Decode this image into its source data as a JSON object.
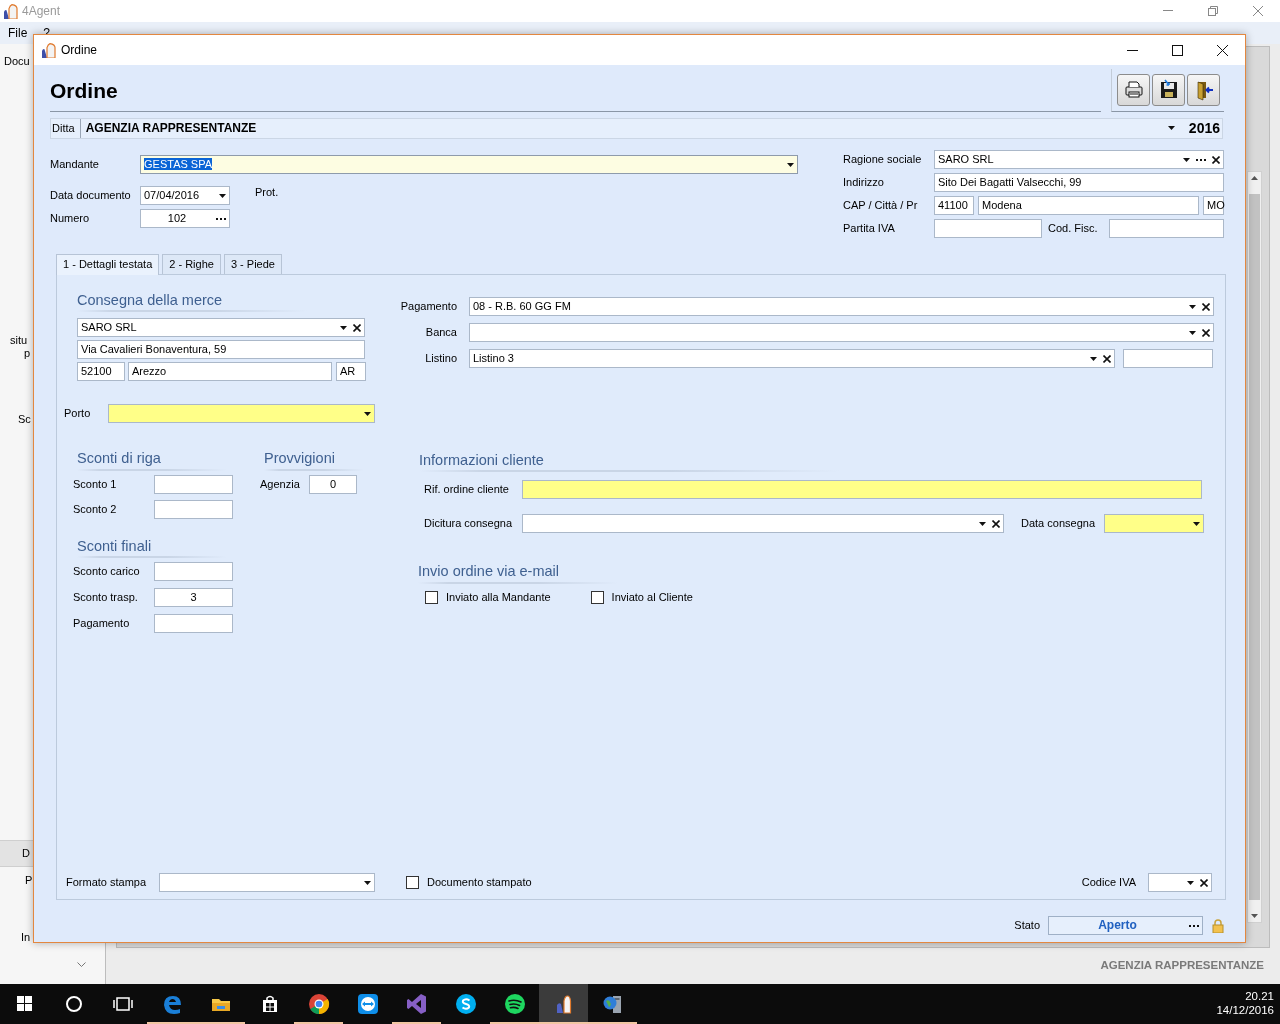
{
  "app": {
    "title": "4Agent",
    "menu": [
      {
        "label": "File"
      },
      {
        "label": "?"
      }
    ],
    "background_texts": [
      "Docu",
      "situ",
      "p",
      "Sc",
      "D",
      "P",
      "In"
    ],
    "footer": "AGENZIA RAPPRESENTANZE"
  },
  "dialog": {
    "title": "Ordine",
    "heading": "Ordine",
    "ditta": {
      "label": "Ditta",
      "value": "AGENZIA RAPPRESENTANZE",
      "year": "2016"
    },
    "mandante": {
      "label": "Mandante",
      "value": "GESTAS SPA",
      "focused": true,
      "text_selected": true,
      "dropdown": true
    },
    "data_documento": {
      "label": "Data documento",
      "value": "07/04/2016",
      "dropdown": true
    },
    "prot": {
      "label": "Prot."
    },
    "numero": {
      "label": "Numero",
      "value": "102",
      "lookup": true
    },
    "cliente": {
      "ragione_sociale": {
        "label": "Ragione sociale",
        "value": "SARO SRL",
        "dropdown": true,
        "lookup": true,
        "clearable": true
      },
      "indirizzo": {
        "label": "Indirizzo",
        "value": "Sito Dei Bagatti Valsecchi, 99"
      },
      "cap_citta_pr": {
        "label": "CAP / Città / Pr",
        "cap": "41100",
        "citta": "Modena",
        "pr": "MO"
      },
      "partita_iva": {
        "label": "Partita IVA"
      },
      "cod_fisc": {
        "label": "Cod. Fisc."
      }
    },
    "tabs": [
      {
        "label": "1 - Dettagli testata",
        "selected": true
      },
      {
        "label": "2 - Righe",
        "selected": false
      },
      {
        "label": "3 - Piede",
        "selected": false
      }
    ],
    "consegna": {
      "title": "Consegna della merce",
      "ragione_sociale": {
        "value": "SARO SRL",
        "dropdown": true,
        "clearable": true
      },
      "indirizzo": "Via Cavalieri Bonaventura, 59",
      "cap": "52100",
      "citta": "Arezzo",
      "pr": "AR"
    },
    "porto": {
      "label": "Porto",
      "required": true,
      "dropdown": true
    },
    "pagamento": {
      "label": "Pagamento",
      "value": "08 - R.B. 60 GG FM",
      "dropdown": true,
      "clearable": true
    },
    "banca": {
      "label": "Banca",
      "dropdown": true,
      "clearable": true
    },
    "listino": {
      "label": "Listino",
      "value": "Listino 3",
      "dropdown": true,
      "clearable": true
    },
    "sconti_riga": {
      "title": "Sconti di riga",
      "fields": [
        {
          "label": "Sconto 1"
        },
        {
          "label": "Sconto 2"
        }
      ]
    },
    "provvigioni": {
      "title": "Provvigioni",
      "fields": [
        {
          "label": "Agenzia",
          "value": "0"
        }
      ]
    },
    "sconti_finali": {
      "title": "Sconti finali",
      "fields": [
        {
          "label": "Sconto carico"
        },
        {
          "label": "Sconto trasp.",
          "value": "3"
        },
        {
          "label": "Pagamento"
        }
      ]
    },
    "info_cliente": {
      "title": "Informazioni cliente",
      "rif_ordine": {
        "label": "Rif. ordine cliente",
        "required": true
      },
      "dicitura": {
        "label": "Dicitura consegna",
        "dropdown": true,
        "clearable": true
      },
      "data_consegna": {
        "label": "Data consegna",
        "required": true,
        "dropdown": true
      }
    },
    "invio_email": {
      "title": "Invio ordine via e-mail",
      "options": [
        {
          "label": "Inviato alla Mandante",
          "checked": false
        },
        {
          "label": "Inviato al Cliente",
          "checked": false
        }
      ]
    },
    "formato_stampa": {
      "label": "Formato stampa",
      "dropdown": true
    },
    "documento_stampato": {
      "label": "Documento stampato",
      "checked": false
    },
    "codice_iva": {
      "label": "Codice IVA",
      "dropdown": true,
      "clearable": true
    },
    "stato": {
      "label": "Stato",
      "value": "Aperto",
      "lookup": true,
      "locked": true
    }
  },
  "taskbar": {
    "apps": [
      {
        "kind": "start"
      },
      {
        "kind": "search"
      },
      {
        "kind": "task-view"
      },
      {
        "kind": "edge",
        "running": true,
        "active": false
      },
      {
        "kind": "explorer",
        "running": true,
        "active": false
      },
      {
        "kind": "store",
        "running": false,
        "active": false
      },
      {
        "kind": "chrome",
        "running": true,
        "active": false
      },
      {
        "kind": "teamviewer",
        "running": false,
        "active": false
      },
      {
        "kind": "visual-studio",
        "running": true,
        "active": false
      },
      {
        "kind": "skype",
        "running": false,
        "active": false
      },
      {
        "kind": "spotify",
        "running": true,
        "active": false
      },
      {
        "kind": "agent",
        "running": true,
        "active": true
      },
      {
        "kind": "network-app",
        "running": true,
        "active": false
      }
    ],
    "time": "20.21",
    "date": "14/12/2016"
  }
}
